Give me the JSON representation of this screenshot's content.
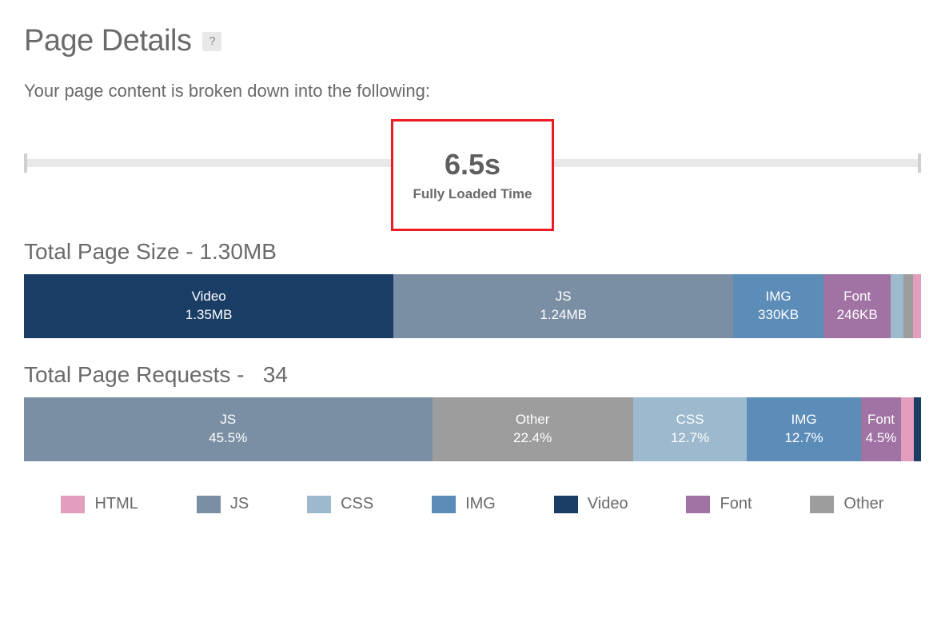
{
  "header": {
    "title": "Page Details",
    "help_glyph": "?",
    "subhead": "Your page content is broken down into the following:"
  },
  "load": {
    "value": "6.5s",
    "label": "Fully Loaded Time"
  },
  "colors": {
    "HTML": "#e39ebd",
    "JS": "#7b8fa4",
    "CSS": "#9cb9ce",
    "IMG": "#5c8cb8",
    "Video": "#1a3d66",
    "Font": "#a172a4",
    "Other": "#9d9d9d"
  },
  "legend": [
    "HTML",
    "JS",
    "CSS",
    "IMG",
    "Video",
    "Font",
    "Other"
  ],
  "size": {
    "title_prefix": "Total Page Size - ",
    "title_value": "1.30MB",
    "segments": [
      {
        "label": "Video",
        "value": "1.35MB",
        "cat": "Video",
        "weight": 1.35,
        "show": true
      },
      {
        "label": "JS",
        "value": "1.24MB",
        "cat": "JS",
        "weight": 1.24,
        "show": true
      },
      {
        "label": "IMG",
        "value": "330KB",
        "cat": "IMG",
        "weight": 0.33,
        "show": true
      },
      {
        "label": "Font",
        "value": "246KB",
        "cat": "Font",
        "weight": 0.246,
        "show": true
      },
      {
        "label": "CSS",
        "value": "",
        "cat": "CSS",
        "weight": 0.045,
        "show": false
      },
      {
        "label": "Other",
        "value": "",
        "cat": "Other",
        "weight": 0.035,
        "show": false
      },
      {
        "label": "HTML",
        "value": "",
        "cat": "HTML",
        "weight": 0.03,
        "show": false
      }
    ]
  },
  "requests": {
    "title_prefix": "Total Page Requests - ",
    "title_value": "  34",
    "segments": [
      {
        "label": "JS",
        "value": "45.5%",
        "cat": "JS",
        "weight": 45.5,
        "show": true
      },
      {
        "label": "Other",
        "value": "22.4%",
        "cat": "Other",
        "weight": 22.4,
        "show": true
      },
      {
        "label": "CSS",
        "value": "12.7%",
        "cat": "CSS",
        "weight": 12.7,
        "show": true
      },
      {
        "label": "IMG",
        "value": "12.7%",
        "cat": "IMG",
        "weight": 12.7,
        "show": true
      },
      {
        "label": "Font",
        "value": "4.5%",
        "cat": "Font",
        "weight": 4.5,
        "show": true
      },
      {
        "label": "HTML",
        "value": "",
        "cat": "HTML",
        "weight": 1.4,
        "show": false
      },
      {
        "label": "Video",
        "value": "",
        "cat": "Video",
        "weight": 0.8,
        "show": false
      }
    ]
  },
  "chart_data": [
    {
      "type": "bar",
      "title": "Total Page Size - 1.30MB",
      "categories": [
        "Video",
        "JS",
        "IMG",
        "Font",
        "CSS",
        "Other",
        "HTML"
      ],
      "values_label": [
        "1.35MB",
        "1.24MB",
        "330KB",
        "246KB",
        "",
        "",
        ""
      ],
      "values_mb": [
        1.35,
        1.24,
        0.33,
        0.246,
        0.045,
        0.035,
        0.03
      ]
    },
    {
      "type": "bar",
      "title": "Total Page Requests - 34",
      "categories": [
        "JS",
        "Other",
        "CSS",
        "IMG",
        "Font",
        "HTML",
        "Video"
      ],
      "values_pct": [
        45.5,
        22.4,
        12.7,
        12.7,
        4.5,
        1.4,
        0.8
      ]
    }
  ]
}
